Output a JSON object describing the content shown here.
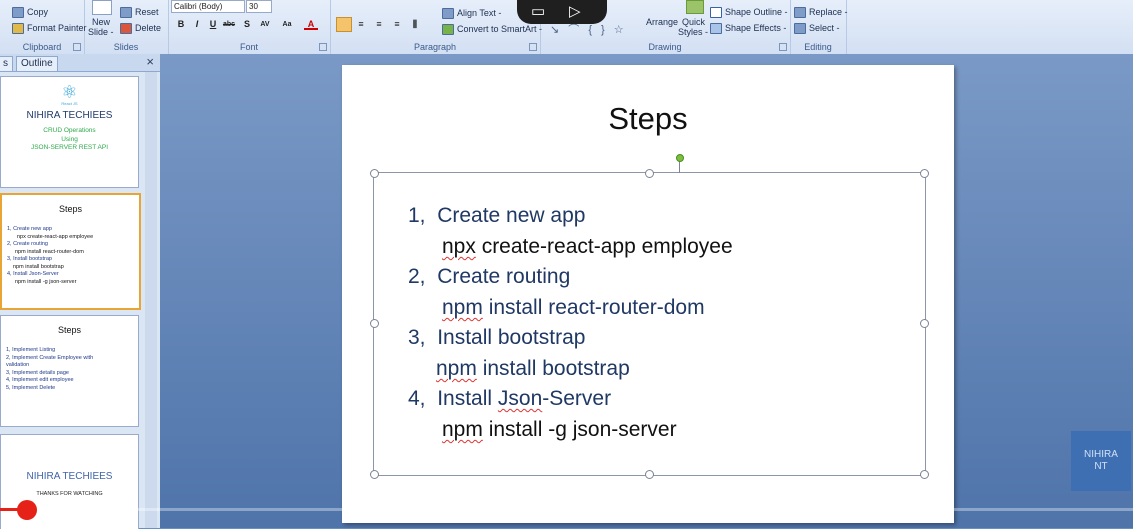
{
  "ribbon": {
    "clipboard": {
      "copy": "Copy",
      "format_painter": "Format Painter",
      "label": "Clipboard"
    },
    "slides": {
      "new_slide": "New",
      "new_slide2": "Slide -",
      "reset": "Reset",
      "delete": "Delete",
      "label": "Slides"
    },
    "font": {
      "font_name": "Calibri (Body)",
      "font_size": "30",
      "label": "Font"
    },
    "paragraph": {
      "align_text": "Align Text -",
      "convert": "Convert to SmartArt -",
      "label": "Paragraph"
    },
    "drawing": {
      "arrange": "Arrange",
      "quick_styles": "Quick",
      "quick_styles2": "Styles -",
      "shape_outline": "Shape Outline -",
      "shape_effects": "Shape Effects -",
      "label": "Drawing"
    },
    "editing": {
      "replace": "Replace -",
      "select": "Select -",
      "label": "Editing"
    }
  },
  "panel": {
    "tab_slides": "s",
    "tab_outline": "Outline",
    "close": "×",
    "thumbs": [
      {
        "react_label": "React JS",
        "title": "NIHIRA TECHIEES",
        "line1": "CRUD Operations",
        "line2": "Using",
        "line3": "JSON-SERVER REST API"
      },
      {
        "title": "Steps",
        "lines": [
          "1,  Create new app",
          "npx create-react-app employee",
          "2,  Create routing",
          "npm install react-router-dom",
          "3,  Install bootstrap",
          "npm install bootstrap",
          "4,  Install Json-Server",
          "npm install -g json-server"
        ]
      },
      {
        "title": "Steps",
        "lines": [
          "1,  Implement Listing",
          "2,  Implement Create Employee with",
          "validation",
          "3, Implement details page",
          "4, Implement edit employee",
          "5, Implement Delete"
        ]
      },
      {
        "title": "NIHIRA TECHIEES",
        "line1": "THANKS FOR WATCHING"
      }
    ]
  },
  "slide": {
    "title": "Steps",
    "steps": [
      {
        "num": "1,",
        "text": "Create new app",
        "cmd_a": "npx",
        "cmd_b": " create-react-app employee"
      },
      {
        "num": "2,",
        "text": "Create routing",
        "cmd_a": "npm",
        "cmd_b": " install react-router-dom"
      },
      {
        "num": "3,",
        "text": "Install bootstrap",
        "cmd_a": "npm",
        "cmd_b": " install bootstrap"
      },
      {
        "num": "4,",
        "text": "Install ",
        "text_b": "Json",
        "text_c": "-Server",
        "cmd_a": "npm",
        "cmd_b": " install -g json-server"
      }
    ]
  },
  "watermark": {
    "line1": "NIHIRA",
    "line2": "NT"
  },
  "video": {
    "progress": 0.024
  }
}
